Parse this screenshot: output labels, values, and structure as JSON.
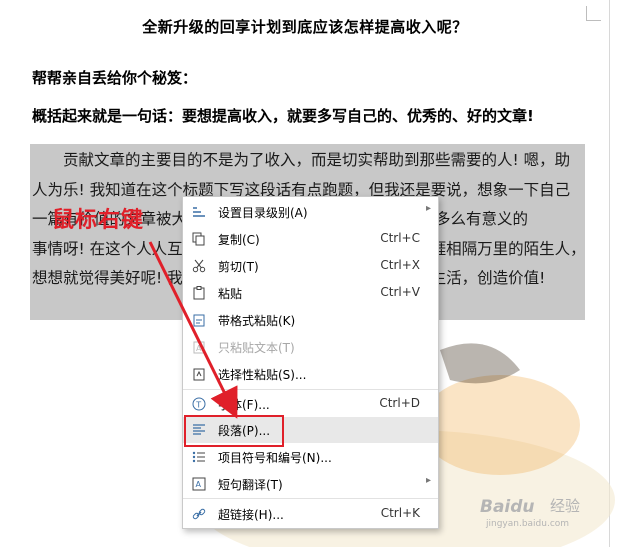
{
  "document": {
    "title": "全新升级的回享计划到底应该怎样提高收入呢？",
    "line1": "帮帮亲自丢给你个秘笈：",
    "line2": "概括起来就是一句话：要想提高收入，就要多写自己的、优秀的、好的文章!",
    "paragraph": [
      "贡献文章的主要目的不是为了收入，而是切实帮助到那些需要的人! 嗯，助",
      "人为乐! 我知道在这个标题下写这段话有点跑题，但我还是要说，想象一下自己",
      "一篇有价值的文章被大家看到，为他们解决问题，这是一件多么有意义的",
      "事情呀! 在这个人人互联的时代，用自己的知识帮助远在天涯相隔万里的陌生人，",
      "想想就觉得美好呢! 我们也能在这个过程中提升自我，丰富生活，创造价值!"
    ]
  },
  "annotation": {
    "label": "鼠标右键",
    "color": "#e0202a"
  },
  "context_menu": {
    "items": [
      {
        "icon": "outline-level-icon",
        "label": "设置目录级别(A)",
        "shortcut": "",
        "submenu": true,
        "disabled": false
      },
      {
        "icon": "copy-icon",
        "label": "复制(C)",
        "shortcut": "Ctrl+C",
        "submenu": false,
        "disabled": false
      },
      {
        "icon": "cut-icon",
        "label": "剪切(T)",
        "shortcut": "Ctrl+X",
        "submenu": false,
        "disabled": false
      },
      {
        "icon": "paste-icon",
        "label": "粘贴",
        "shortcut": "Ctrl+V",
        "submenu": false,
        "disabled": false
      },
      {
        "icon": "paste-format-icon",
        "label": "带格式粘贴(K)",
        "shortcut": "",
        "submenu": false,
        "disabled": false
      },
      {
        "icon": "paste-text-icon",
        "label": "只粘贴文本(T)",
        "shortcut": "",
        "submenu": false,
        "disabled": true
      },
      {
        "icon": "paste-special-icon",
        "label": "选择性粘贴(S)...",
        "shortcut": "",
        "submenu": false,
        "disabled": false
      },
      {
        "icon": "font-icon",
        "label": "字体(F)...",
        "shortcut": "Ctrl+D",
        "submenu": false,
        "disabled": false
      },
      {
        "icon": "paragraph-icon",
        "label": "段落(P)...",
        "shortcut": "",
        "submenu": false,
        "disabled": false,
        "highlighted": true
      },
      {
        "icon": "bullets-numbering-icon",
        "label": "项目符号和编号(N)...",
        "shortcut": "",
        "submenu": false,
        "disabled": false
      },
      {
        "icon": "translate-icon",
        "label": "短句翻译(T)",
        "shortcut": "",
        "submenu": true,
        "disabled": false
      },
      {
        "icon": "hyperlink-icon",
        "label": "超链接(H)...",
        "shortcut": "Ctrl+K",
        "submenu": false,
        "disabled": false
      }
    ]
  },
  "watermark": {
    "brand": "Baidu",
    "brand_cn": "经验",
    "url": "jingyan.baidu.com"
  }
}
